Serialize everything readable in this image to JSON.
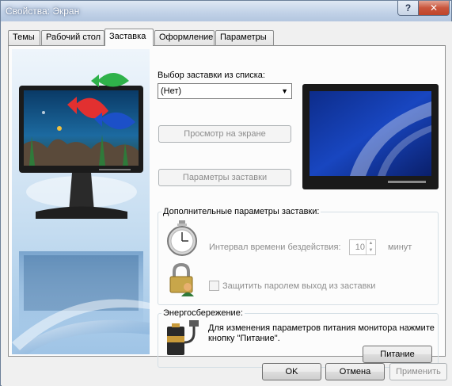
{
  "window": {
    "title": "Свойства: Экран",
    "help_button": "?",
    "close_button": "✕"
  },
  "tabs": [
    {
      "label": "Темы",
      "active": false
    },
    {
      "label": "Рабочий стол",
      "active": false
    },
    {
      "label": "Заставка",
      "active": true
    },
    {
      "label": "Оформление",
      "active": false
    },
    {
      "label": "Параметры",
      "active": false
    }
  ],
  "screensaver": {
    "select_label": "Выбор заставки из списка:",
    "selected_value": "(Нет)",
    "preview_button": "Просмотр на экране",
    "settings_button": "Параметры заставки"
  },
  "extra": {
    "group_title": "Дополнительные параметры заставки:",
    "idle_label": "Интервал времени бездействия:",
    "idle_value": "10",
    "idle_unit": "минут",
    "password_label": "Защитить паролем выход из заставки",
    "password_checked": false
  },
  "power": {
    "group_title": "Энергосбережение:",
    "description": "Для изменения параметров питания монитора нажмите кнопку \"Питание\".",
    "power_button": "Питание"
  },
  "footer": {
    "ok": "OK",
    "cancel": "Отмена",
    "apply": "Применить"
  },
  "icons": {
    "stopwatch": "stopwatch-icon",
    "lock": "lock-user-icon",
    "battery": "battery-plug-icon",
    "dropdown": "chevron-down-icon"
  }
}
